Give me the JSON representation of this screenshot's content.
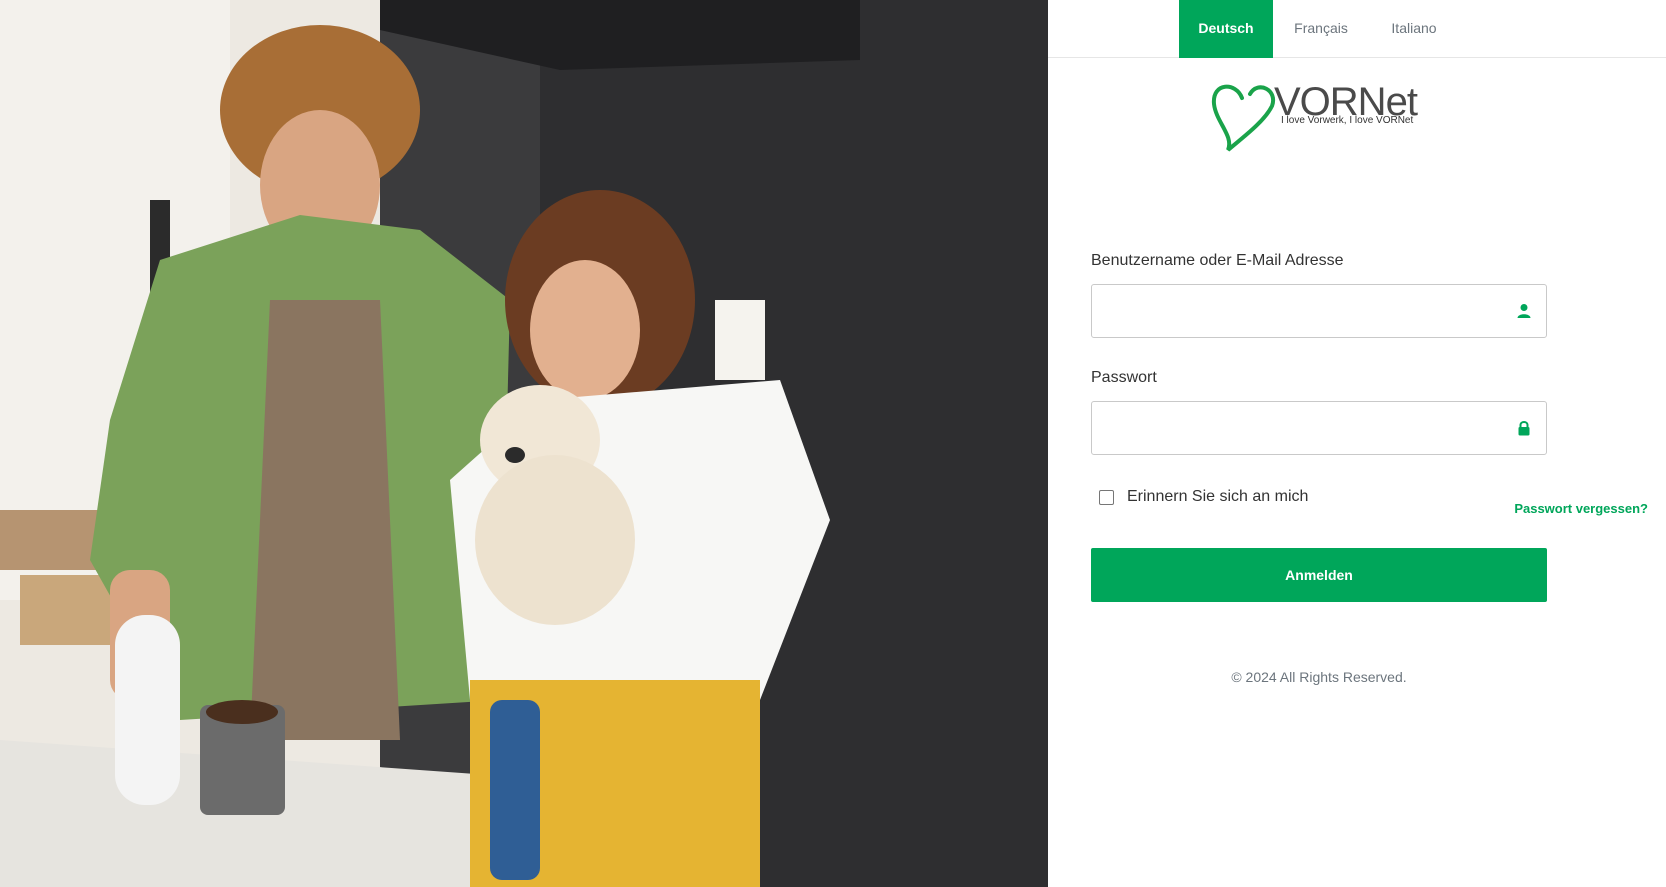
{
  "languages": [
    {
      "label": "Deutsch",
      "active": true
    },
    {
      "label": "Français",
      "active": false
    },
    {
      "label": "Italiano",
      "active": false
    }
  ],
  "logo": {
    "wordmark": "VORNet",
    "tagline": "I love Vorwerk, I love VORNet",
    "icon": "heart-outline-icon"
  },
  "form": {
    "username_label": "Benutzername oder E-Mail Adresse",
    "username_value": "",
    "username_icon": "user-icon",
    "password_label": "Passwort",
    "password_value": "",
    "password_icon": "lock-icon",
    "remember_label": "Erinnern Sie sich an mich",
    "remember_checked": false,
    "forgot_label": "Passwort vergessen?",
    "submit_label": "Anmelden"
  },
  "footer": {
    "copyright": "© 2024 All Rights Reserved."
  },
  "colors": {
    "accent": "#00a65a",
    "text": "#333333",
    "muted": "#6c757d"
  }
}
